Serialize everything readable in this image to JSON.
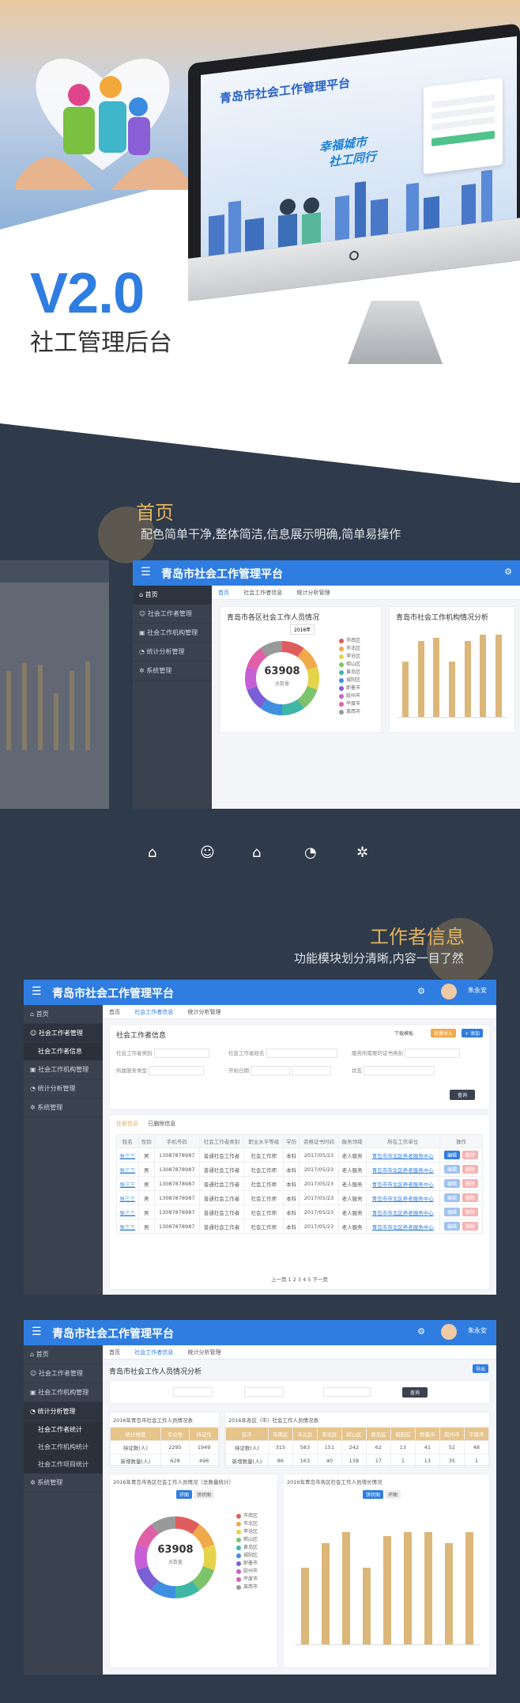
{
  "hero": {
    "monitor_title": "青岛市社会工作管理平台",
    "slogan_line1": "幸福城市",
    "slogan_line2": "社工同行",
    "version": "V2.0",
    "subtitle": "社工管理后台"
  },
  "section1": {
    "title": "首页",
    "subtitle": "配色简单干净,整体简洁,信息展示明确,简单易操作"
  },
  "section2": {
    "title": "工作者信息",
    "subtitle": "功能模块划分清晰,内容一目了然"
  },
  "app": {
    "title": "青岛市社会工作管理平台",
    "user_name": "朱永安",
    "sidebar": [
      "首页",
      "社会工作者管理",
      "社会工作机构管理",
      "统计分析管理",
      "系统管理"
    ],
    "tabs": [
      "首页",
      "社会工作者信息",
      "统计分析管理"
    ]
  },
  "home": {
    "donut_title": "青岛市各区社会工作人员情况",
    "bar_title": "青岛市社会工作机构情况分析",
    "year": "2016年",
    "total": "63908",
    "total_label": "总数量",
    "legend": [
      "市南区",
      "市北区",
      "李沧区",
      "崂山区",
      "黄岛区",
      "城阳区",
      "即墨市",
      "胶州市",
      "平度市",
      "莱西市"
    ],
    "colors": [
      "#e05d5d",
      "#f0a94b",
      "#e6d34c",
      "#7cc46b",
      "#3fb6a8",
      "#3f8fe0",
      "#7a5fd6",
      "#c65fd6",
      "#e05fa8",
      "#999999"
    ],
    "bar_values": [
      38,
      52,
      54,
      38,
      52,
      56,
      56
    ]
  },
  "workers": {
    "page_title": "社会工作者信息",
    "filters": [
      "社会工作者类别",
      "社会工作者姓名",
      "服务所需要的证书类别",
      "所属服务类型",
      "开始日期",
      "状态"
    ],
    "search_btn": "查询",
    "import_btn": "批量导入",
    "add_btn": "+ 添加",
    "download_btn": "下载模板",
    "sub_tabs": [
      "在册信息",
      "已删除信息"
    ],
    "headers": [
      "姓名",
      "性别",
      "手机号码",
      "社会工作者类别",
      "职业水平等级",
      "学历",
      "资格证书时间",
      "服务领域",
      "所在工作单位",
      "操作"
    ],
    "rows": [
      [
        "张三三",
        "男",
        "13087878987",
        "普通社会工作者",
        "社会工作师",
        "本科",
        "2017/05/23",
        "老人服务",
        "青岛市市北区养老服务中心"
      ],
      [
        "张三三",
        "男",
        "13087878987",
        "普通社会工作者",
        "社会工作师",
        "本科",
        "2017/05/23",
        "老人服务",
        "青岛市市北区养老服务中心"
      ],
      [
        "张三三",
        "男",
        "13087878987",
        "普通社会工作者",
        "社会工作师",
        "本科",
        "2017/05/23",
        "老人服务",
        "青岛市市北区养老服务中心"
      ],
      [
        "张三三",
        "男",
        "13087878987",
        "普通社会工作者",
        "社会工作师",
        "本科",
        "2017/05/23",
        "老人服务",
        "青岛市市北区养老服务中心"
      ],
      [
        "张三三",
        "男",
        "13087878987",
        "普通社会工作者",
        "社会工作师",
        "本科",
        "2017/05/23",
        "老人服务",
        "青岛市市北区养老服务中心"
      ],
      [
        "张三三",
        "男",
        "13087878987",
        "普通社会工作者",
        "社会工作师",
        "本科",
        "2017/05/23",
        "老人服务",
        "青岛市市北区养老服务中心"
      ]
    ],
    "edit_label": "编辑",
    "del_label": "删除",
    "pager": "上一页  1  2  3  4  5  下一页"
  },
  "stats": {
    "page_title": "青岛市社会工作人员情况分析",
    "export_btn": "导出",
    "search_btn": "查询",
    "sidebar_sub": [
      "社会工作者统计",
      "社会工作机构统计",
      "社会工作项目统计"
    ],
    "table1_title": "2016年青岛市社会工作人员情况表",
    "table1_headers": [
      "统计维度",
      "专业性",
      "持证性"
    ],
    "table1_rows": [
      [
        "持证数(人)",
        "2295",
        "1949"
      ],
      [
        "新增数量(人)",
        "628",
        "496"
      ]
    ],
    "table2_title": "2016年各区（市）社会工作人员情况表",
    "table2_headers": [
      "区市",
      "市南区",
      "市北区",
      "李沧区",
      "崂山区",
      "黄岛区",
      "城阳区",
      "即墨市",
      "胶州市",
      "平度市"
    ],
    "table2_rows": [
      [
        "持证数(人)",
        "315",
        "583",
        "151",
        "242",
        "62",
        "13",
        "41",
        "52",
        "48"
      ],
      [
        "新增数量(人)",
        "86",
        "163",
        "40",
        "138",
        "17",
        "1",
        "13",
        "35",
        "1"
      ]
    ],
    "donut_title": "2016年青岛市各区社会工作人员情况（总数量统计）",
    "bar_title": "2016年青岛市各区社会工作人员增长情况",
    "toggle": [
      "环图",
      "饼状图"
    ],
    "bar_values": [
      34,
      45,
      50,
      34,
      48,
      50,
      50,
      45,
      50
    ]
  }
}
